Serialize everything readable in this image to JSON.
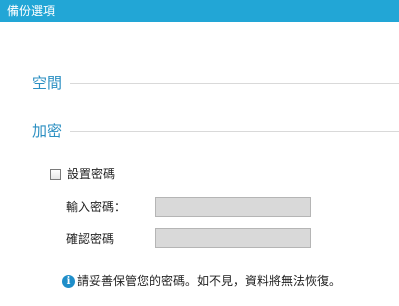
{
  "window": {
    "title": "備份選項"
  },
  "sections": {
    "space": "空間",
    "encryption": "加密"
  },
  "encryption": {
    "set_password_label": "設置密碼",
    "set_password_checked": false,
    "enter_password_label": "輸入密碼：",
    "enter_password_value": "",
    "confirm_password_label": "確認密碼",
    "confirm_password_value": "",
    "note": "請妥善保管您的密碼。如不見，資料將無法恢復。",
    "info_icon_glyph": "i"
  },
  "colors": {
    "titlebar": "#22a6d6",
    "section_heading": "#2b8fc2",
    "input_disabled": "#d9d9d9",
    "info_icon": "#1f8ec9"
  },
  "icons": {
    "info": "info-icon"
  }
}
